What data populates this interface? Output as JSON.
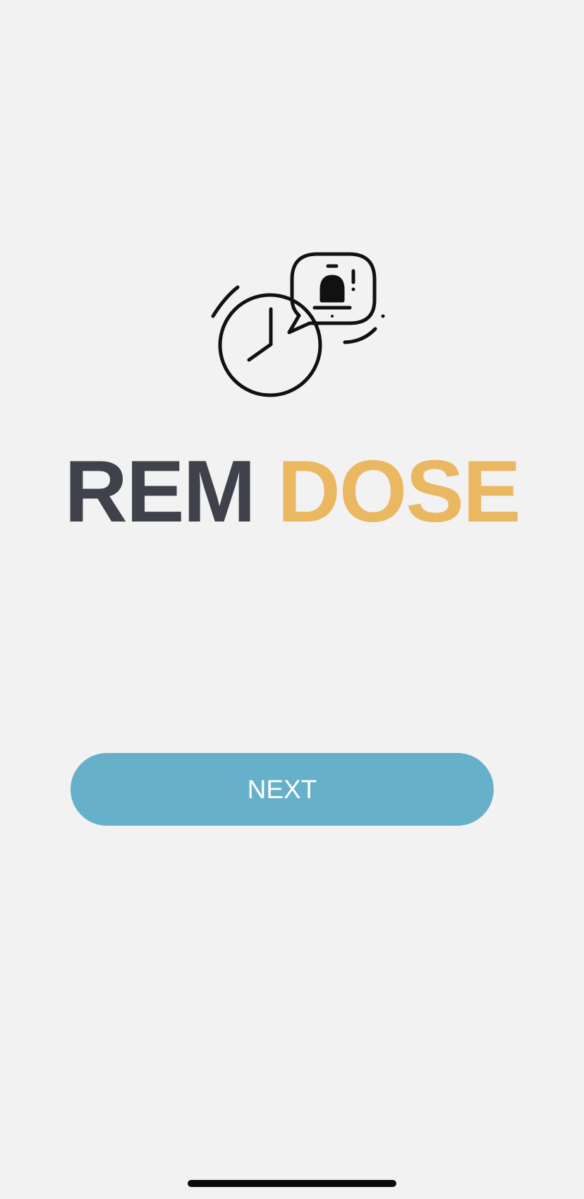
{
  "app": {
    "title_part_1": "REM",
    "title_part_2": "DOSE",
    "logo_icon": "clock-with-bell-notification-icon"
  },
  "actions": {
    "next_label": "NEXT"
  },
  "colors": {
    "background": "#f2f2f2",
    "title_dark": "#3f414b",
    "title_accent": "#ebb862",
    "button": "#66b0c9",
    "button_text": "#ffffff"
  }
}
